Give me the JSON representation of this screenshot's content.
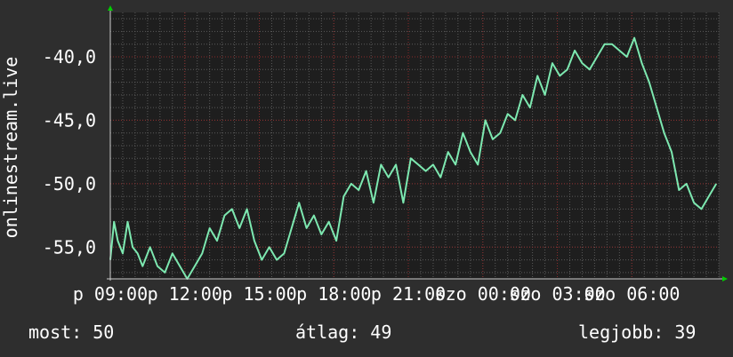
{
  "chart_data": {
    "type": "line",
    "ylabel": "onlinestream.live",
    "ylim": [
      -57.5,
      -36.5
    ],
    "yticks": [
      -40,
      -45,
      -50,
      -55
    ],
    "ytick_labels": [
      "-40,0",
      "-45,0",
      "-50,0",
      "-55,0"
    ],
    "xlim": [
      0,
      24.5
    ],
    "xticks": [
      0,
      3,
      6,
      9,
      12,
      15,
      18,
      21
    ],
    "xtick_labels": [
      "p 09:00",
      "p 12:00",
      "p 15:00",
      "p 18:00",
      "p 21:00",
      "szo 00:00",
      "szo 03:00",
      "szo 06:00"
    ],
    "grid": true,
    "series": [
      {
        "color": "#7de8b0",
        "x": [
          0.0,
          0.15,
          0.3,
          0.5,
          0.7,
          0.9,
          1.1,
          1.3,
          1.6,
          1.9,
          2.2,
          2.5,
          2.8,
          3.1,
          3.4,
          3.7,
          4.0,
          4.3,
          4.6,
          4.9,
          5.2,
          5.5,
          5.8,
          6.1,
          6.4,
          6.7,
          7.0,
          7.3,
          7.6,
          7.9,
          8.2,
          8.5,
          8.8,
          9.1,
          9.4,
          9.7,
          10.0,
          10.3,
          10.6,
          10.9,
          11.2,
          11.5,
          11.8,
          12.1,
          12.4,
          12.7,
          13.0,
          13.3,
          13.6,
          13.9,
          14.2,
          14.5,
          14.8,
          15.1,
          15.4,
          15.7,
          16.0,
          16.3,
          16.6,
          16.9,
          17.2,
          17.5,
          17.8,
          18.1,
          18.4,
          18.7,
          19.0,
          19.3,
          19.6,
          19.9,
          20.2,
          20.5,
          20.8,
          21.1,
          21.4,
          21.7,
          22.0,
          22.3,
          22.6,
          22.9,
          23.2,
          23.5,
          23.8,
          24.1,
          24.4
        ],
        "values": [
          -56.0,
          -53.0,
          -54.5,
          -55.5,
          -53.0,
          -55.0,
          -55.5,
          -56.5,
          -55.0,
          -56.5,
          -57.0,
          -55.5,
          -56.5,
          -57.5,
          -56.5,
          -55.5,
          -53.5,
          -54.5,
          -52.5,
          -52.0,
          -53.5,
          -52.0,
          -54.5,
          -56.0,
          -55.0,
          -56.0,
          -55.5,
          -53.5,
          -51.5,
          -53.5,
          -52.5,
          -54.0,
          -53.0,
          -54.5,
          -51.0,
          -50.0,
          -50.5,
          -49.0,
          -51.5,
          -48.5,
          -49.5,
          -48.5,
          -51.5,
          -48.0,
          -48.5,
          -49.0,
          -48.5,
          -49.5,
          -47.5,
          -48.5,
          -46.0,
          -47.5,
          -48.5,
          -45.0,
          -46.5,
          -46.0,
          -44.5,
          -45.0,
          -43.0,
          -44.0,
          -41.5,
          -43.0,
          -40.5,
          -41.5,
          -41.0,
          -39.5,
          -40.5,
          -41.0,
          -40.0,
          -39.0,
          -39.0,
          -39.5,
          -40.0,
          -38.5,
          -40.5,
          -42.0,
          -44.0,
          -46.0,
          -47.5,
          -50.5,
          -50.0,
          -51.5,
          -52.0,
          -51.0,
          -50.0
        ]
      }
    ]
  },
  "stats": {
    "now": "most: 50",
    "avg": "átlag: 49",
    "best": "legjobb: 39"
  },
  "colors": {
    "background": "#2e2e2e",
    "plot_bg": "#1e1e1e",
    "grid_major": "#8a2a2a",
    "grid_minor": "#5a5a5a",
    "line": "#7de8b0",
    "axis_arrow": "#00cc00"
  }
}
